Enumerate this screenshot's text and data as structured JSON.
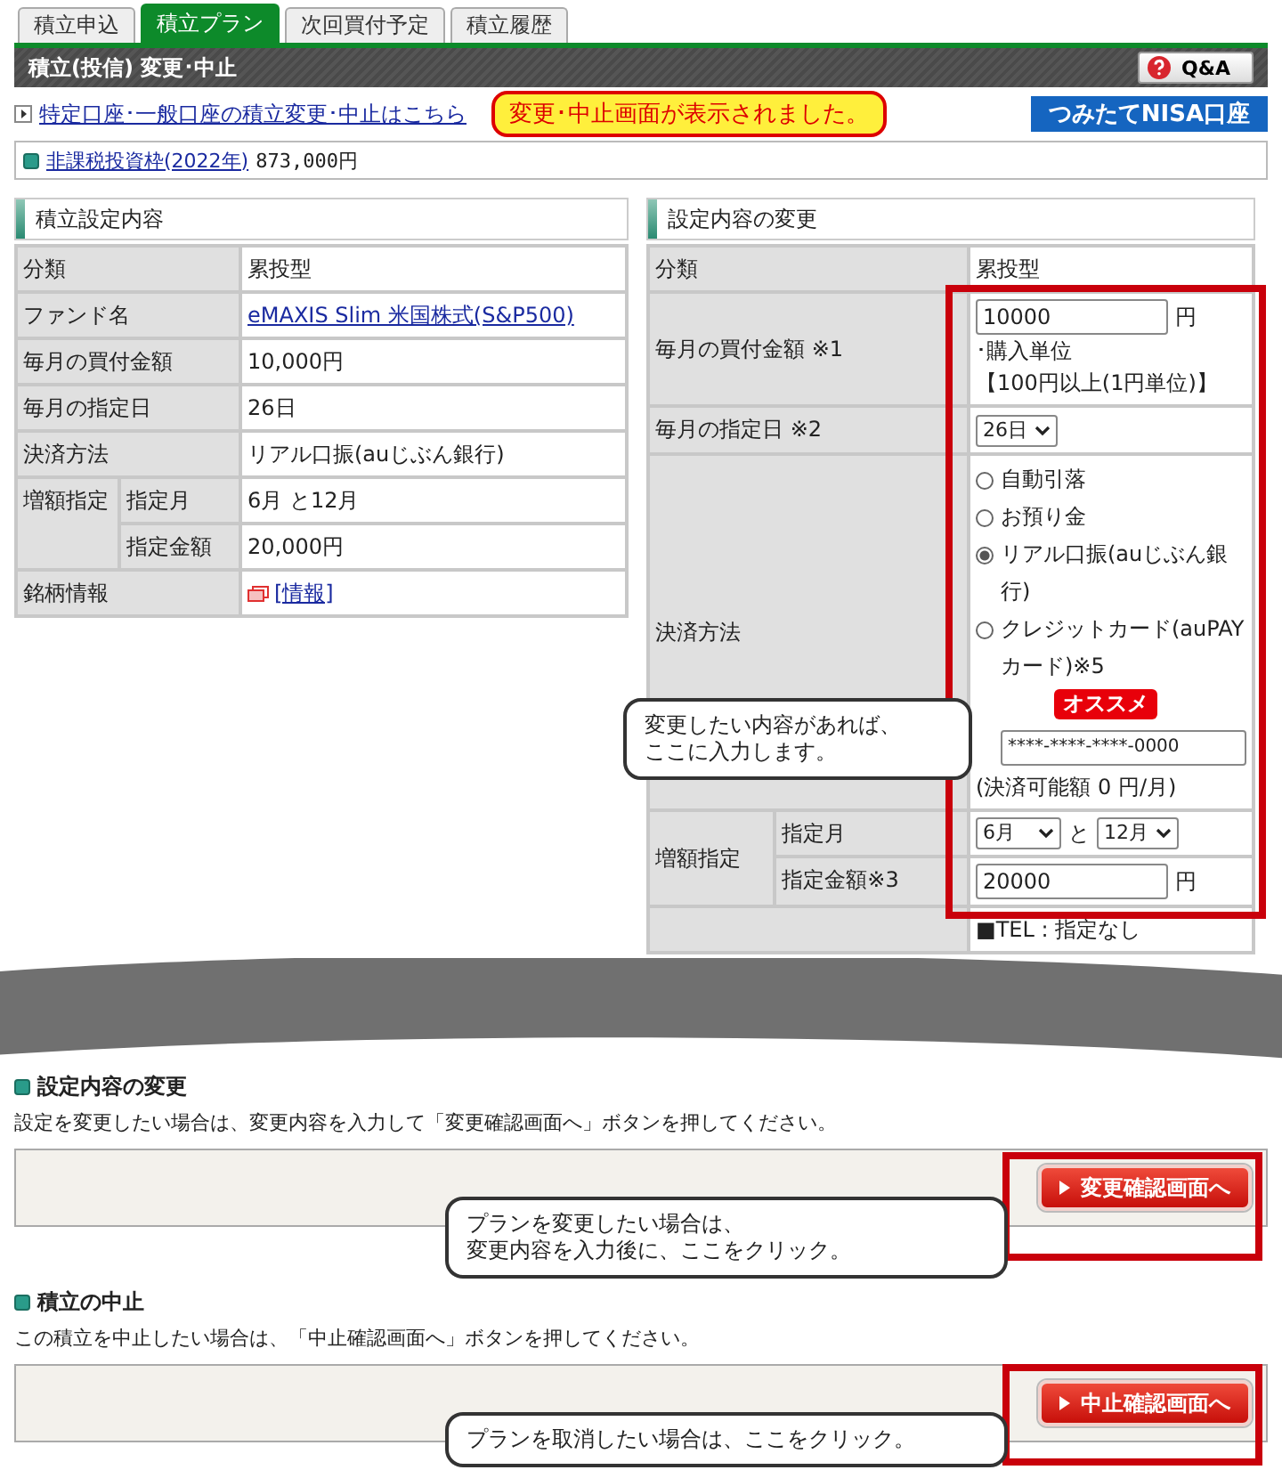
{
  "tabs": [
    {
      "label": "積立申込",
      "selected": false
    },
    {
      "label": "積立プラン",
      "selected": true
    },
    {
      "label": "次回買付予定",
      "selected": false
    },
    {
      "label": "積立履歴",
      "selected": false
    }
  ],
  "title": "積立(投信) 変更･中止",
  "qa_button": "Q&A",
  "account_link": "特定口座･一般口座の積立変更･中止はこちら",
  "notice": "変更･中止画面が表示されました。",
  "nisa_badge": "つみたてNISA口座",
  "tax_free": {
    "link": "非課税投資枠(2022年)",
    "amount": "873,000円"
  },
  "current": {
    "heading": "積立設定内容",
    "rows": [
      {
        "kind": "text",
        "label": "分類",
        "value": "累投型"
      },
      {
        "kind": "link",
        "label": "ファンド名",
        "value": "eMAXIS Slim 米国株式(S&P500)"
      },
      {
        "kind": "text",
        "label": "毎月の買付金額",
        "value": "10,000円"
      },
      {
        "kind": "text",
        "label": "毎月の指定日",
        "value": "26日"
      },
      {
        "kind": "text",
        "label": "決済方法",
        "value": "リアル口振(auじぶん銀行)"
      },
      {
        "kind": "group",
        "label": "増額指定",
        "children": [
          {
            "label": "指定月",
            "value": "6月 と12月"
          },
          {
            "label": "指定金額",
            "value": "20,000円"
          }
        ]
      },
      {
        "kind": "info",
        "label": "銘柄情報",
        "value": "[情報]"
      }
    ]
  },
  "change": {
    "heading": "設定内容の変更",
    "rows": [
      {
        "kind": "text",
        "label": "分類",
        "value": "累投型"
      },
      {
        "kind": "amount",
        "label": "毎月の買付金額 ※1",
        "value": "10000",
        "unit": "円",
        "notes": [
          "･購入単位",
          "【100円以上(1円単位)】"
        ]
      },
      {
        "kind": "select",
        "label": "毎月の指定日 ※2",
        "value": "26日"
      },
      {
        "kind": "payment",
        "label": "決済方法",
        "options": [
          {
            "label": "自動引落",
            "selected": false
          },
          {
            "label": "お預り金",
            "selected": false
          },
          {
            "label": "リアル口振(auじぶん銀行)",
            "selected": true
          },
          {
            "label": "クレジットカード(auPAYカード)※5",
            "selected": false,
            "badge": "オススメ"
          }
        ],
        "card_number": "****-****-****-0000",
        "note": "(決済可能額 0 円/月)"
      },
      {
        "kind": "group",
        "label": "増額指定",
        "children": [
          {
            "kind": "months",
            "label": "指定月",
            "from": "6月",
            "joiner": "と",
            "to": "12月"
          },
          {
            "kind": "amount",
            "label": "指定金額※3",
            "value": "20000",
            "unit": "円"
          }
        ]
      },
      {
        "kind": "tel",
        "value": "■TEL : 指定なし"
      }
    ]
  },
  "callouts": [
    {
      "lines": [
        "変更したい内容があれば、",
        "ここに入力します。"
      ]
    },
    {
      "lines": [
        "プランを変更したい場合は、",
        "変更内容を入力後に、ここをクリック。"
      ]
    },
    {
      "lines": [
        "プランを取消したい場合は、ここをクリック。"
      ]
    }
  ],
  "sections": [
    {
      "heading": "設定内容の変更",
      "description": "設定を変更したい場合は、変更内容を入力して「変更確認画面へ」ボタンを押してください。",
      "button": "変更確認画面へ"
    },
    {
      "heading": "積立の中止",
      "description": "この積立を中止したい場合は、「中止確認画面へ」ボタンを押してください。",
      "button": "中止確認画面へ"
    }
  ]
}
